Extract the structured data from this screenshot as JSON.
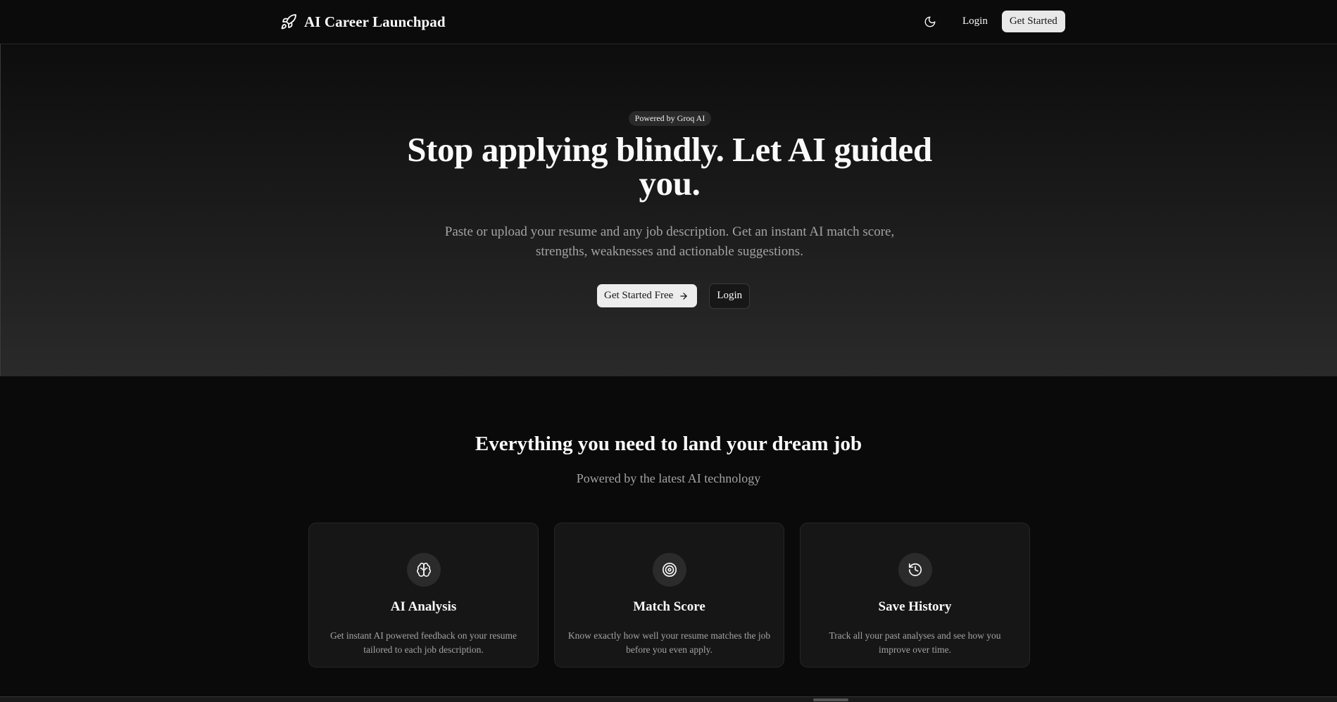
{
  "header": {
    "brand_icon": "rocket-icon",
    "brand_title": "AI Career Launchpad",
    "theme_icon": "moon-icon",
    "login_label": "Login",
    "get_started_label": "Get Started"
  },
  "hero": {
    "badge": "Powered by Groq AI",
    "title": "Stop applying blindly. Let AI guided you.",
    "subtitle": "Paste or upload your resume and any job description. Get an instant AI match score, strengths, weaknesses and actionable suggestions.",
    "primary_cta": "Get Started Free",
    "primary_cta_icon": "arrow-right-icon",
    "secondary_cta": "Login"
  },
  "features": {
    "title": "Everything you need to land your dream job",
    "subtitle": "Powered by the latest AI technology",
    "cards": [
      {
        "icon": "brain-icon",
        "title": "AI Analysis",
        "description": "Get instant AI powered feedback on your resume tailored to each job description."
      },
      {
        "icon": "target-icon",
        "title": "Match Score",
        "description": "Know exactly how well your resume matches the job before you even apply."
      },
      {
        "icon": "history-icon",
        "title": "Save History",
        "description": "Track all your past analyses and see how you improve over time."
      }
    ]
  },
  "colors": {
    "background": "#0a0a0a",
    "card": "#161616",
    "text": "#fafafa",
    "muted_text": "#a3a3a3",
    "button_light": "#ededed"
  }
}
